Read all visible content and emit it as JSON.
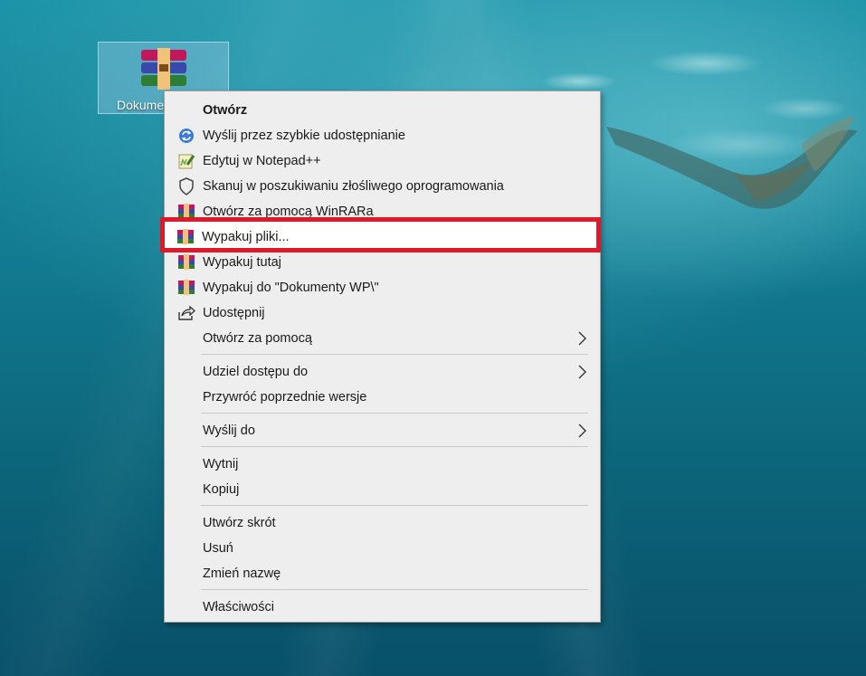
{
  "desktop": {
    "icon_label": "Dokume"
  },
  "context_menu": {
    "items": [
      {
        "label": "Otwórz",
        "icon": "none",
        "bold": true
      },
      {
        "label": "Wyślij przez szybkie udostępnianie",
        "icon": "nearby-share-icon"
      },
      {
        "label": "Edytuj w Notepad++",
        "icon": "notepadplusplus-icon"
      },
      {
        "label": "Skanuj w poszukiwaniu złośliwego oprogramowania",
        "icon": "shield-icon"
      },
      {
        "label": "Otwórz za pomocą WinRARa",
        "icon": "winrar-icon"
      },
      {
        "label": "Wypakuj pliki...",
        "icon": "winrar-icon",
        "highlighted": true
      },
      {
        "label": "Wypakuj tutaj",
        "icon": "winrar-icon"
      },
      {
        "label": "Wypakuj do \"Dokumenty WP\\\"",
        "icon": "winrar-icon"
      },
      {
        "label": "Udostępnij",
        "icon": "share-icon"
      },
      {
        "label": "Otwórz za pomocą",
        "submenu": true
      },
      {
        "label": "Udziel dostępu do",
        "submenu": true
      },
      {
        "label": "Przywróć poprzednie wersje"
      },
      {
        "label": "Wyślij do",
        "submenu": true
      },
      {
        "label": "Wytnij"
      },
      {
        "label": "Kopiuj"
      },
      {
        "label": "Utwórz skrót"
      },
      {
        "label": "Usuń"
      },
      {
        "label": "Zmień nazwę"
      },
      {
        "label": "Właściwości"
      }
    ]
  },
  "colors": {
    "highlight_border": "#e0182a",
    "menu_bg": "#eeeeee"
  }
}
